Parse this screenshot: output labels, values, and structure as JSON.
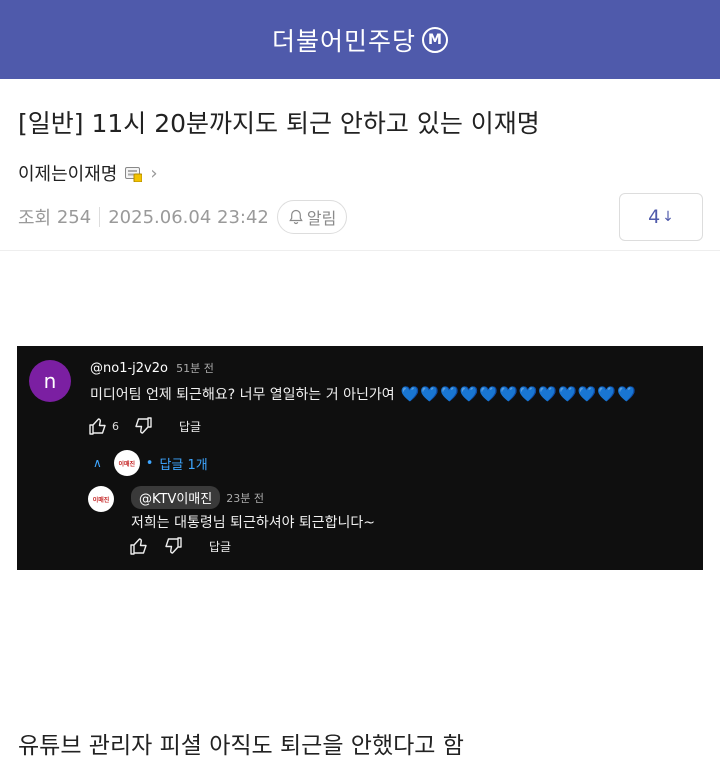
{
  "header": {
    "board_name": "더불어민주당",
    "board_badge": "M"
  },
  "post": {
    "title": "[일반] 11시 20분까지도 퇴근 안하고 있는 이재명",
    "author": "이제는이재명",
    "views_label": "조회",
    "views": "254",
    "datetime": "2025.06.04 23:42",
    "alarm_label": "알림",
    "comment_count": "4",
    "comment_sort_glyph": "↓",
    "body": "유튜브 관리자 피셜 아직도 퇴근을 안했다고 함"
  },
  "embedded_screenshot": {
    "comment": {
      "avatar_letter": "n",
      "user": "@no1-j2v2o",
      "time": "51분 전",
      "text": "미디어팀 언제 퇴근해요? 너무 열일하는 거 아닌가여",
      "hearts": "💙💙💙💙💙💙💙💙💙💙💙💙",
      "likes": "6",
      "reply_label": "답글",
      "replies_toggle": "답글 1개"
    },
    "reply": {
      "avatar_text": "이매진",
      "user": "@KTV이매진",
      "time": "23분 전",
      "text": "저희는 대통령님 퇴근하셔야 퇴근합니다~",
      "reply_label": "답글"
    }
  },
  "colors": {
    "header_bg": "#4f5aab",
    "accent": "#4f5aab",
    "yt_bg": "#0f0f0f",
    "yt_link": "#3ea6ff"
  }
}
